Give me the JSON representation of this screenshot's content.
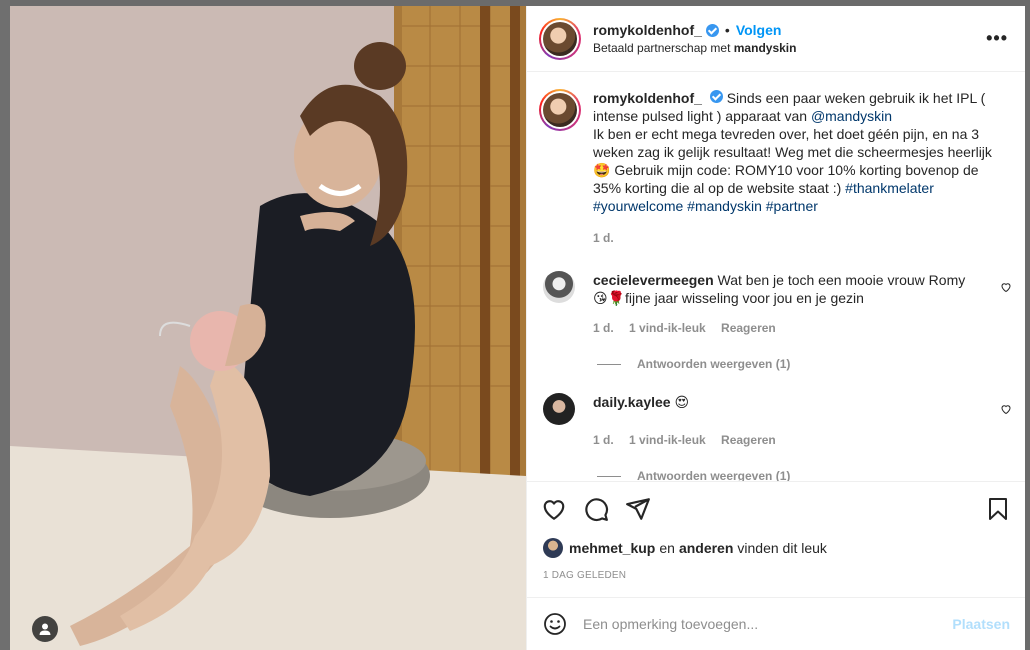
{
  "header": {
    "username": "romykoldenhof_",
    "separator": "•",
    "follow_label": "Volgen",
    "partnership_prefix": "Betaald partnerschap met",
    "partner": "mandyskin",
    "more_label": "•••"
  },
  "caption": {
    "username": "romykoldenhof_",
    "text_1": "Sinds een paar weken gebruik ik het IPL ( intense pulsed light ) apparaat van",
    "mention": "@mandyskin",
    "text_2": "Ik ben er echt mega tevreden over, het doet géén pijn, en na 3 weken zag ik gelijk resultaat! Weg met die scheermesjes heerlijk 🤩 Gebruik mijn code: ROMY10 voor 10% korting bovenop de 35% korting die al op de website staat :)",
    "hashtag_1": "#thankmelater",
    "hashtags_2": "#yourwelcome #mandyskin #partner",
    "time": "1 d."
  },
  "comments": [
    {
      "username": "cecielevermeegen",
      "text": "Wat ben je toch een mooie vrouw Romy 😘🌹fijne jaar wisseling voor jou en je gezin",
      "time": "1 d.",
      "likes": "1 vind-ik-leuk",
      "reply": "Reageren",
      "view_replies": "Antwoorden weergeven (1)"
    },
    {
      "username": "daily.kaylee",
      "text": "😍",
      "time": "1 d.",
      "likes": "1 vind-ik-leuk",
      "reply": "Reageren",
      "view_replies": "Antwoorden weergeven (1)"
    }
  ],
  "likes": {
    "user": "mehmet_kup",
    "middle": "en",
    "others": "anderen",
    "suffix": "vinden dit leuk"
  },
  "date_label": "1 DAG GELEDEN",
  "add_comment": {
    "placeholder": "Een opmerking toevoegen...",
    "post_label": "Plaatsen"
  },
  "colors": {
    "accent": "#0095f6",
    "verified": "#3897f0",
    "link": "#00376b",
    "muted": "#8e8e8e"
  },
  "icons": [
    "verified-badge-icon",
    "more-options-icon",
    "heart-icon",
    "comment-icon",
    "share-icon",
    "bookmark-icon",
    "emoji-icon",
    "profile-tag-icon"
  ]
}
